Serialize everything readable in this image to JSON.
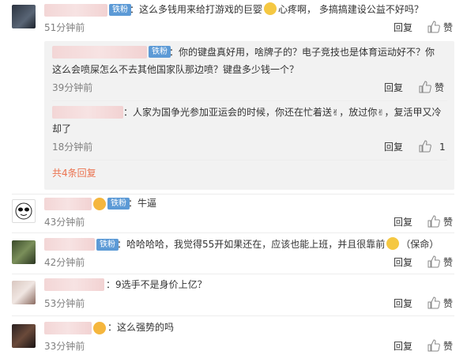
{
  "comments": [
    {
      "badge": "铁粉",
      "text_a": "：这么多钱用来给打游戏的巨婴",
      "text_b": "心疼啊，  多搞搞建设公益不好吗？",
      "time": "51分钟前",
      "reply": "回复",
      "like": "赞",
      "replies": [
        {
          "badge": "铁粉",
          "line1": "：你的键盘真好用，啥牌子的？电子竞技也是体育运动好不？你",
          "line2": "这么会喷屎怎么不去其他国家队那边喷？键盘多少钱一个？",
          "time": "39分钟前",
          "reply": "回复",
          "like": "赞"
        },
        {
          "line1_a": "：人家为国争光参加亚运会的时候，你还在忙着送",
          "line1_b": "，放过你",
          "line1_c": "，复活甲又冷",
          "line2": "却了",
          "time": "18分钟前",
          "reply": "回复",
          "like_count": "1"
        }
      ],
      "more": "共4条回复"
    },
    {
      "badge": "铁粉",
      "text": "：牛逼",
      "time": "43分钟前",
      "reply": "回复",
      "like": "赞"
    },
    {
      "badge": "铁粉",
      "text_a": "：哈哈哈哈，我觉得55开如果还在，应该也能上班，并且很靠前",
      "text_b": "（保命）",
      "time": "42分钟前",
      "reply": "回复",
      "like": "赞"
    },
    {
      "text": "：9选手不是身价上亿？",
      "time": "53分钟前",
      "reply": "回复",
      "like": "赞"
    },
    {
      "text": "：这么强势的吗",
      "time": "33分钟前",
      "reply": "回复",
      "like": "赞"
    }
  ],
  "colors": {
    "badge": "#5c9ad6",
    "more": "#eb7350",
    "reply_bg": "#f2f2f2"
  }
}
